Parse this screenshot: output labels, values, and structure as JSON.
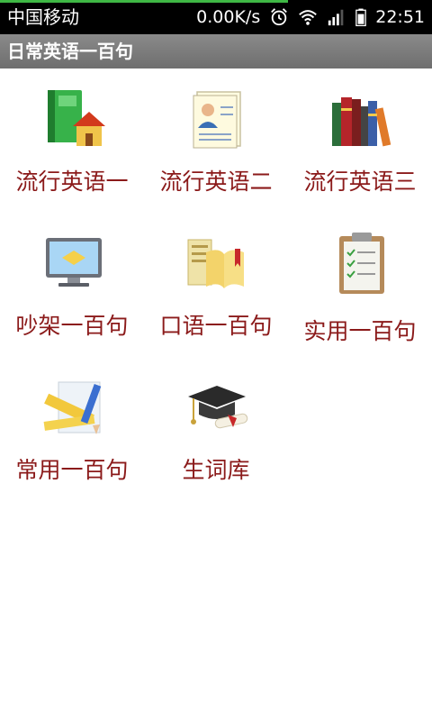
{
  "status_bar": {
    "carrier": "中国移动",
    "network_speed": "0.00K/s",
    "time": "22:51",
    "icons": [
      "alarm-icon",
      "wifi-icon",
      "signal-icon",
      "battery-icon"
    ],
    "progress_color": "#3fb845"
  },
  "app": {
    "title": "日常英语一百句"
  },
  "grid": {
    "label_color": "#8b1a1a",
    "items": [
      {
        "label": "流行英语一",
        "icon": "green-book-house-icon"
      },
      {
        "label": "流行英语二",
        "icon": "resume-card-icon"
      },
      {
        "label": "流行英语三",
        "icon": "bookshelf-icon"
      },
      {
        "label": "吵架一百句",
        "icon": "monitor-icon"
      },
      {
        "label": "口语一百句",
        "icon": "open-book-icon"
      },
      {
        "label": "实用一百句",
        "icon": "clipboard-icon"
      },
      {
        "label": "常用一百句",
        "icon": "ruler-pencil-icon"
      },
      {
        "label": "生词库",
        "icon": "graduation-cap-icon"
      }
    ]
  }
}
